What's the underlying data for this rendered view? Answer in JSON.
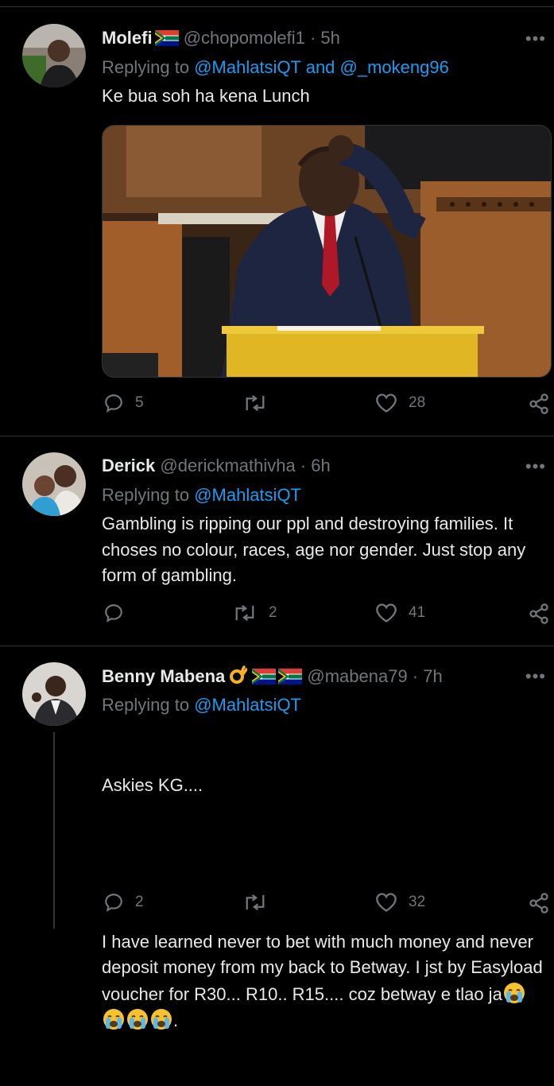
{
  "tweets": [
    {
      "name": "Molefi",
      "handle": "@chopomolefi1 · 5h",
      "reply_prefix": "Replying to ",
      "reply_mentions": "@MahlatsiQT and @_mokeng96",
      "text": "Ke bua soh ha kena Lunch",
      "image": "man-scratching-head-at-podium-photo",
      "replies": "5",
      "retweets": "",
      "likes": "28"
    },
    {
      "name": "Derick",
      "handle": "@derickmathivha · 6h",
      "reply_prefix": "Replying to ",
      "reply_mentions": "@MahlatsiQT",
      "text": "Gambling is ripping our ppl and destroying families. It choses no colour, races, age nor gender. Just stop any form of gambling.",
      "replies": "",
      "retweets": "2",
      "likes": "41"
    },
    {
      "name": "Benny Mabena",
      "handle": "@mabena79 · 7h",
      "reply_prefix": "Replying to ",
      "reply_mentions": "@MahlatsiQT",
      "text_line1": "Askies KG....",
      "text_line2": "I have learned never to bet with much money and never deposit money from my back to Betway. I jst by Easyload voucher for R30... R10.. R15.... coz betway e tlao ja",
      "text_end": ".",
      "replies": "2",
      "retweets": "",
      "likes": "32"
    }
  ],
  "more_label": "•••",
  "colors": {
    "background": "#000000",
    "text": "#e7e9ea",
    "secondary": "#71767b",
    "link": "#1d9bf0",
    "divider": "#2f3336"
  }
}
